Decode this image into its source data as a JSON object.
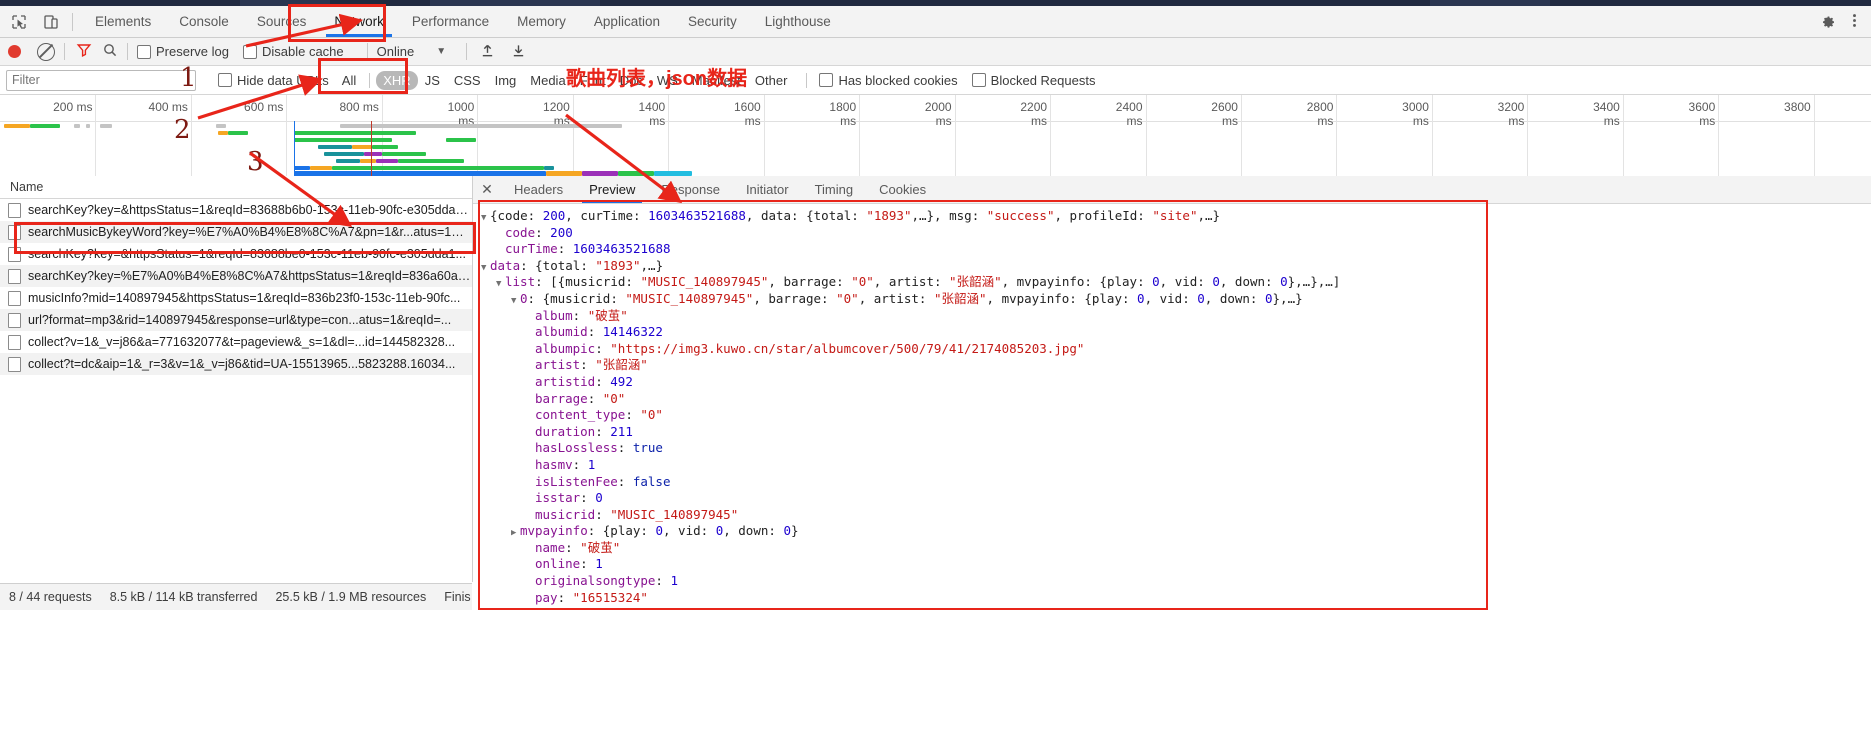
{
  "devtools": {
    "main_tabs": [
      {
        "label": "Elements",
        "active": false
      },
      {
        "label": "Console",
        "active": false
      },
      {
        "label": "Sources",
        "active": false
      },
      {
        "label": "Network",
        "active": true
      },
      {
        "label": "Performance",
        "active": false
      },
      {
        "label": "Memory",
        "active": false
      },
      {
        "label": "Application",
        "active": false
      },
      {
        "label": "Security",
        "active": false
      },
      {
        "label": "Lighthouse",
        "active": false
      }
    ],
    "icons": {
      "inspect": "inspect-element-icon",
      "device": "device-toolbar-icon",
      "settings": "gear-icon",
      "more": "more-options-icon"
    }
  },
  "network_toolbar": {
    "record_icon": "record-icon",
    "clear_icon": "clear-icon",
    "filter_icon": "filter-funnel-icon",
    "search_icon": "search-icon",
    "preserve_log_label": "Preserve log",
    "preserve_log_checked": false,
    "disable_cache_label": "Disable cache",
    "disable_cache_checked": false,
    "throttle_value": "Online",
    "throttle_caret": "▼",
    "import_icon": "import-har-icon",
    "export_icon": "export-har-icon"
  },
  "filter_bar": {
    "filter_placeholder": "Filter",
    "filter_value": "",
    "hide_data_urls_label": "Hide data URLs",
    "hide_data_urls_checked": false,
    "types": [
      {
        "label": "All",
        "selected": false
      },
      {
        "label": "XHR",
        "selected": true
      },
      {
        "label": "JS",
        "selected": false
      },
      {
        "label": "CSS",
        "selected": false
      },
      {
        "label": "Img",
        "selected": false
      },
      {
        "label": "Media",
        "selected": false
      },
      {
        "label": "Font",
        "selected": false
      },
      {
        "label": "Doc",
        "selected": false
      },
      {
        "label": "WS",
        "selected": false
      },
      {
        "label": "Manifest",
        "selected": false
      },
      {
        "label": "Other",
        "selected": false
      }
    ],
    "blocked_cookies_label": "Has blocked cookies",
    "blocked_cookies_checked": false,
    "blocked_requests_label": "Blocked Requests",
    "blocked_requests_checked": false
  },
  "overview": {
    "ticks": [
      "200 ms",
      "400 ms",
      "600 ms",
      "800 ms",
      "1000 ms",
      "1200 ms",
      "1400 ms",
      "1600 ms",
      "1800 ms",
      "2000 ms",
      "2200 ms",
      "2400 ms",
      "2600 ms",
      "2800 ms",
      "3000 ms",
      "3200 ms",
      "3400 ms",
      "3600 ms",
      "3800"
    ],
    "colors": {
      "green": "#2bc34a",
      "orange": "#f5a623",
      "teal": "#18929b",
      "purple": "#9b30b8",
      "blue": "#1a73e8",
      "cyan": "#22bde0",
      "grey": "#c4c4c4",
      "dcl": "#1a73e8",
      "load": "#c0392b"
    }
  },
  "requests": {
    "column_name": "Name",
    "rows": [
      {
        "name": "searchKey?key=&httpsStatus=1&reqId=83688b6b0-153c-11eb-90fc-e305dda1...",
        "selected": false
      },
      {
        "name": "searchMusicBykeyWord?key=%E7%A0%B4%E8%8C%A7&pn=1&r...atus=1&r...",
        "selected": true
      },
      {
        "name": "searchKey?key=&httpsStatus=1&reqId=83688be0-153c-11eb-90fc-e305dda1...",
        "selected": false
      },
      {
        "name": "searchKey?key=%E7%A0%B4%E8%8C%A7&httpsStatus=1&reqId=836a60a0-...",
        "selected": false
      },
      {
        "name": "musicInfo?mid=140897945&httpsStatus=1&reqId=836b23f0-153c-11eb-90fc...",
        "selected": false
      },
      {
        "name": "url?format=mp3&rid=140897945&response=url&type=con...atus=1&reqId=...",
        "selected": false
      },
      {
        "name": "collect?v=1&_v=j86&a=771632077&t=pageview&_s=1&dl=...id=144582328...",
        "selected": false
      },
      {
        "name": "collect?t=dc&aip=1&_r=3&v=1&_v=j86&tid=UA-15513965...5823288.16034...",
        "selected": false
      }
    ]
  },
  "status_bar": {
    "requests": "8 / 44 requests",
    "transferred": "8.5 kB / 114 kB transferred",
    "resources": "25.5 kB / 1.9 MB resources",
    "finish": "Finis"
  },
  "detail_panel": {
    "close_icon": "close-icon",
    "tabs": [
      {
        "label": "Headers",
        "active": false
      },
      {
        "label": "Preview",
        "active": true
      },
      {
        "label": "Response",
        "active": false
      },
      {
        "label": "Initiator",
        "active": false
      },
      {
        "label": "Timing",
        "active": false
      },
      {
        "label": "Cookies",
        "active": false
      }
    ]
  },
  "preview_json": {
    "lines": [
      {
        "indent": 0,
        "tri": "open",
        "parts": [
          {
            "t": "plain",
            "v": "{code: "
          },
          {
            "t": "num",
            "v": "200"
          },
          {
            "t": "plain",
            "v": ", curTime: "
          },
          {
            "t": "num",
            "v": "1603463521688"
          },
          {
            "t": "plain",
            "v": ", data: {total: "
          },
          {
            "t": "str",
            "v": "\"1893\""
          },
          {
            "t": "plain",
            "v": ",…}, msg: "
          },
          {
            "t": "str",
            "v": "\"success\""
          },
          {
            "t": "plain",
            "v": ", profileId: "
          },
          {
            "t": "str",
            "v": "\"site\""
          },
          {
            "t": "plain",
            "v": ",…}"
          }
        ]
      },
      {
        "indent": 1,
        "tri": "none",
        "parts": [
          {
            "t": "k",
            "v": "code"
          },
          {
            "t": "plain",
            "v": ": "
          },
          {
            "t": "num",
            "v": "200"
          }
        ]
      },
      {
        "indent": 1,
        "tri": "none",
        "parts": [
          {
            "t": "k",
            "v": "curTime"
          },
          {
            "t": "plain",
            "v": ": "
          },
          {
            "t": "num",
            "v": "1603463521688"
          }
        ]
      },
      {
        "indent": 0,
        "tri": "open",
        "parts": [
          {
            "t": "k",
            "v": "data"
          },
          {
            "t": "plain",
            "v": ": {total: "
          },
          {
            "t": "str",
            "v": "\"1893\""
          },
          {
            "t": "plain",
            "v": ",…}"
          }
        ]
      },
      {
        "indent": 1,
        "tri": "open",
        "parts": [
          {
            "t": "k",
            "v": "list"
          },
          {
            "t": "plain",
            "v": ": [{musicrid: "
          },
          {
            "t": "str",
            "v": "\"MUSIC_140897945\""
          },
          {
            "t": "plain",
            "v": ", barrage: "
          },
          {
            "t": "str",
            "v": "\"0\""
          },
          {
            "t": "plain",
            "v": ", artist: "
          },
          {
            "t": "str",
            "v": "\"张韶涵\""
          },
          {
            "t": "plain",
            "v": ", mvpayinfo: {play: "
          },
          {
            "t": "num",
            "v": "0"
          },
          {
            "t": "plain",
            "v": ", vid: "
          },
          {
            "t": "num",
            "v": "0"
          },
          {
            "t": "plain",
            "v": ", down: "
          },
          {
            "t": "num",
            "v": "0"
          },
          {
            "t": "plain",
            "v": "},…},…]"
          }
        ]
      },
      {
        "indent": 2,
        "tri": "open",
        "parts": [
          {
            "t": "k",
            "v": "0"
          },
          {
            "t": "plain",
            "v": ": {musicrid: "
          },
          {
            "t": "str",
            "v": "\"MUSIC_140897945\""
          },
          {
            "t": "plain",
            "v": ", barrage: "
          },
          {
            "t": "str",
            "v": "\"0\""
          },
          {
            "t": "plain",
            "v": ", artist: "
          },
          {
            "t": "str",
            "v": "\"张韶涵\""
          },
          {
            "t": "plain",
            "v": ", mvpayinfo: {play: "
          },
          {
            "t": "num",
            "v": "0"
          },
          {
            "t": "plain",
            "v": ", vid: "
          },
          {
            "t": "num",
            "v": "0"
          },
          {
            "t": "plain",
            "v": ", down: "
          },
          {
            "t": "num",
            "v": "0"
          },
          {
            "t": "plain",
            "v": "},…}"
          }
        ]
      },
      {
        "indent": 3,
        "tri": "none",
        "parts": [
          {
            "t": "k",
            "v": "album"
          },
          {
            "t": "plain",
            "v": ": "
          },
          {
            "t": "str",
            "v": "\"破茧\""
          }
        ]
      },
      {
        "indent": 3,
        "tri": "none",
        "parts": [
          {
            "t": "k",
            "v": "albumid"
          },
          {
            "t": "plain",
            "v": ": "
          },
          {
            "t": "num",
            "v": "14146322"
          }
        ]
      },
      {
        "indent": 3,
        "tri": "none",
        "parts": [
          {
            "t": "k",
            "v": "albumpic"
          },
          {
            "t": "plain",
            "v": ": "
          },
          {
            "t": "str",
            "v": "\"https://img3.kuwo.cn/star/albumcover/500/79/41/2174085203.jpg\""
          }
        ]
      },
      {
        "indent": 3,
        "tri": "none",
        "parts": [
          {
            "t": "k",
            "v": "artist"
          },
          {
            "t": "plain",
            "v": ": "
          },
          {
            "t": "str",
            "v": "\"张韶涵\""
          }
        ]
      },
      {
        "indent": 3,
        "tri": "none",
        "parts": [
          {
            "t": "k",
            "v": "artistid"
          },
          {
            "t": "plain",
            "v": ": "
          },
          {
            "t": "num",
            "v": "492"
          }
        ]
      },
      {
        "indent": 3,
        "tri": "none",
        "parts": [
          {
            "t": "k",
            "v": "barrage"
          },
          {
            "t": "plain",
            "v": ": "
          },
          {
            "t": "str",
            "v": "\"0\""
          }
        ]
      },
      {
        "indent": 3,
        "tri": "none",
        "parts": [
          {
            "t": "k",
            "v": "content_type"
          },
          {
            "t": "plain",
            "v": ": "
          },
          {
            "t": "str",
            "v": "\"0\""
          }
        ]
      },
      {
        "indent": 3,
        "tri": "none",
        "parts": [
          {
            "t": "k",
            "v": "duration"
          },
          {
            "t": "plain",
            "v": ": "
          },
          {
            "t": "num",
            "v": "211"
          }
        ]
      },
      {
        "indent": 3,
        "tri": "none",
        "parts": [
          {
            "t": "k",
            "v": "hasLossless"
          },
          {
            "t": "plain",
            "v": ": "
          },
          {
            "t": "bool",
            "v": "true"
          }
        ]
      },
      {
        "indent": 3,
        "tri": "none",
        "parts": [
          {
            "t": "k",
            "v": "hasmv"
          },
          {
            "t": "plain",
            "v": ": "
          },
          {
            "t": "num",
            "v": "1"
          }
        ]
      },
      {
        "indent": 3,
        "tri": "none",
        "parts": [
          {
            "t": "k",
            "v": "isListenFee"
          },
          {
            "t": "plain",
            "v": ": "
          },
          {
            "t": "bool",
            "v": "false"
          }
        ]
      },
      {
        "indent": 3,
        "tri": "none",
        "parts": [
          {
            "t": "k",
            "v": "isstar"
          },
          {
            "t": "plain",
            "v": ": "
          },
          {
            "t": "num",
            "v": "0"
          }
        ]
      },
      {
        "indent": 3,
        "tri": "none",
        "parts": [
          {
            "t": "k",
            "v": "musicrid"
          },
          {
            "t": "plain",
            "v": ": "
          },
          {
            "t": "str",
            "v": "\"MUSIC_140897945\""
          }
        ]
      },
      {
        "indent": 2,
        "tri": "closed",
        "parts": [
          {
            "t": "k",
            "v": "mvpayinfo"
          },
          {
            "t": "plain",
            "v": ": {play: "
          },
          {
            "t": "num",
            "v": "0"
          },
          {
            "t": "plain",
            "v": ", vid: "
          },
          {
            "t": "num",
            "v": "0"
          },
          {
            "t": "plain",
            "v": ", down: "
          },
          {
            "t": "num",
            "v": "0"
          },
          {
            "t": "plain",
            "v": "}"
          }
        ]
      },
      {
        "indent": 3,
        "tri": "none",
        "parts": [
          {
            "t": "k",
            "v": "name"
          },
          {
            "t": "plain",
            "v": ": "
          },
          {
            "t": "str",
            "v": "\"破茧\""
          }
        ]
      },
      {
        "indent": 3,
        "tri": "none",
        "parts": [
          {
            "t": "k",
            "v": "online"
          },
          {
            "t": "plain",
            "v": ": "
          },
          {
            "t": "num",
            "v": "1"
          }
        ]
      },
      {
        "indent": 3,
        "tri": "none",
        "parts": [
          {
            "t": "k",
            "v": "originalsongtype"
          },
          {
            "t": "plain",
            "v": ": "
          },
          {
            "t": "num",
            "v": "1"
          }
        ]
      },
      {
        "indent": 3,
        "tri": "none",
        "parts": [
          {
            "t": "k",
            "v": "pay"
          },
          {
            "t": "plain",
            "v": ": "
          },
          {
            "t": "str",
            "v": "\"16515324\""
          }
        ]
      }
    ]
  },
  "annotations": {
    "num1": "1",
    "num2": "2",
    "num3": "3",
    "chinese_note": "歌曲列表，json数据",
    "color": "#e8251a"
  }
}
